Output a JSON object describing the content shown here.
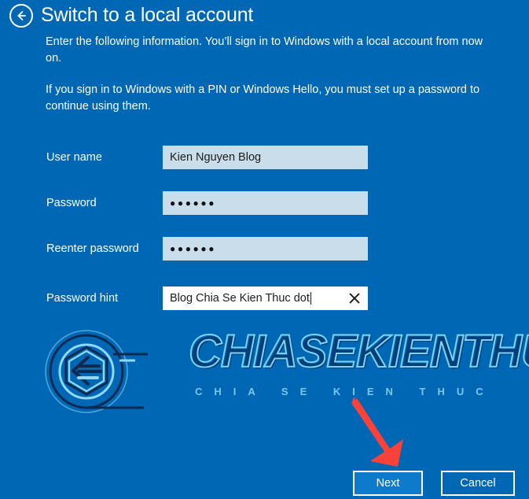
{
  "header": {
    "back_icon": "back-arrow-circle-icon",
    "title": "Switch to a local account"
  },
  "body": {
    "paragraph_1": "Enter the following information. You’ll sign in to Windows with a local account from now on.",
    "paragraph_2": "If you sign in to Windows with a PIN or Windows Hello, you must set up a password to continue using them."
  },
  "form": {
    "fields": [
      {
        "label": "User name",
        "value": "Kien Nguyen Blog",
        "type": "text",
        "focused": false
      },
      {
        "label": "Password",
        "value": "●●●●●●",
        "type": "password",
        "focused": false
      },
      {
        "label": "Reenter password",
        "value": "●●●●●●",
        "type": "password",
        "focused": false
      },
      {
        "label": "Password hint",
        "value": "Blog Chia Se Kien Thuc dot",
        "type": "text",
        "focused": true,
        "clear_icon": "close-x-icon"
      }
    ]
  },
  "watermark": {
    "logo_icon": "chiasekienthuc-logo-icon",
    "text": "CHIASEKIENTHUC",
    "subtitle": "CHIA SE KIEN THUC"
  },
  "annotation": {
    "arrow_icon": "red-pointer-arrow-icon"
  },
  "footer": {
    "next_label": "Next",
    "cancel_label": "Cancel"
  },
  "colors": {
    "background": "#0067B4",
    "field_fill": "#C9DDEA",
    "field_focused_fill": "#FFFFFF",
    "primary_button_fill": "#0E7ACB",
    "text": "#FFFFFF",
    "arrow": "#F8423A",
    "watermark_stroke": "#7FD4F5"
  }
}
